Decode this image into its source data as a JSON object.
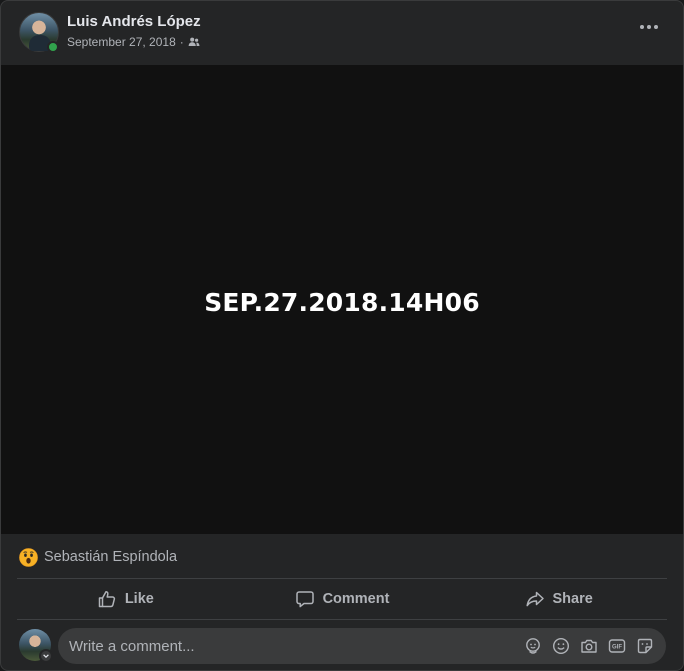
{
  "post": {
    "author": "Luis Andrés López",
    "date": "September 27, 2018",
    "separator": "·",
    "audience_icon": "friends-icon",
    "media_text": "SEP.27.2018.14H06"
  },
  "reactions": {
    "icon": "wow-reaction-icon",
    "names": "Sebastián Espíndola"
  },
  "actions": {
    "like_label": "Like",
    "comment_label": "Comment",
    "share_label": "Share"
  },
  "comment": {
    "placeholder": "Write a comment...",
    "tools": [
      "avatar-sticker-icon",
      "emoji-icon",
      "camera-icon",
      "gif-icon",
      "sticker-icon"
    ]
  },
  "colors": {
    "card_bg": "#242526",
    "media_bg": "#111111",
    "text_primary": "#e4e6eb",
    "text_secondary": "#b0b3b8",
    "online": "#31a24c",
    "input_bg": "#3a3b3c"
  }
}
